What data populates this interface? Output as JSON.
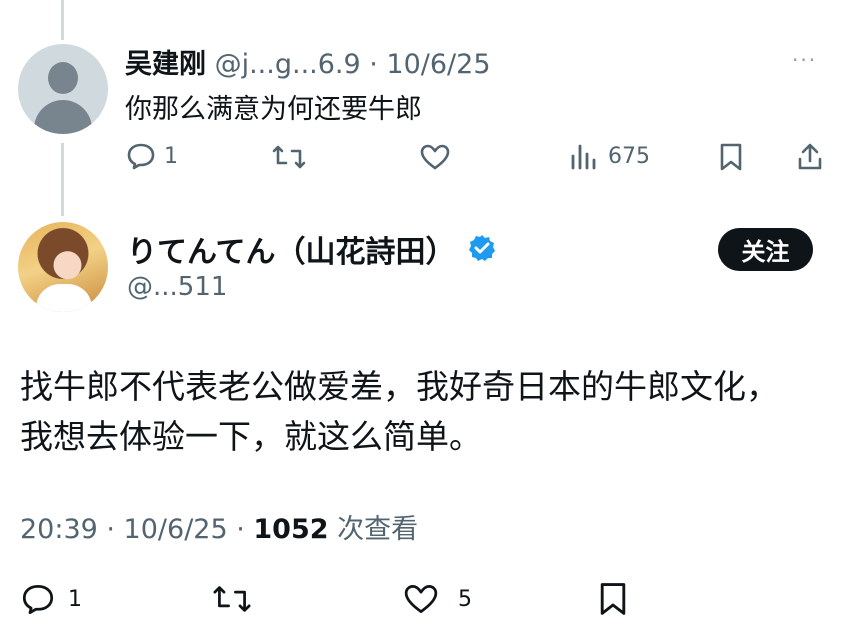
{
  "reply": {
    "name": "吴建刚",
    "handle": "@j...g...6.9",
    "date": "· 10/6/25",
    "text": "你那么满意为何还要牛郎",
    "more": "···",
    "actions": {
      "replies": "1",
      "retweets": "",
      "likes": "",
      "views": "675"
    }
  },
  "tweet": {
    "name": "りてんてん（山花詩田）",
    "handle": "@...511",
    "follow_label": "关注",
    "text_lines": [
      "找牛郎不代表老公做爱差，我好奇日本的牛郎文化，",
      "我想去体验一下，就这么简单。"
    ],
    "time": "20:39 · 10/6/25 · ",
    "views_count": "1052",
    "views_label": " 次查看",
    "actions": {
      "replies": "1",
      "likes": "5"
    }
  },
  "colors": {
    "text_primary": "#0f1419",
    "text_secondary": "#536471",
    "verified": "#1d9bf0",
    "follow_bg": "#0f1419"
  }
}
